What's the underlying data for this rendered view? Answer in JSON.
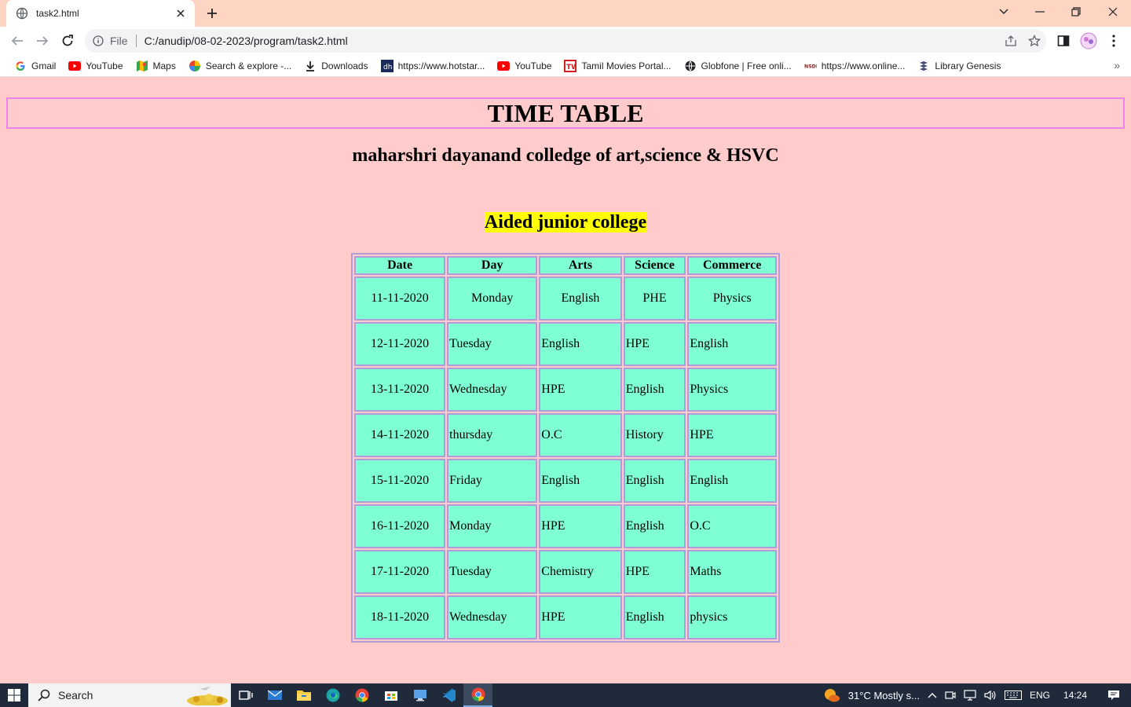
{
  "browser": {
    "tab_title": "task2.html",
    "address_prefix": "File",
    "url": "C:/anudip/08-02-2023/program/task2.html",
    "bookmarks": [
      {
        "label": "Gmail",
        "icon": "gmail-icon"
      },
      {
        "label": "YouTube",
        "icon": "youtube-icon"
      },
      {
        "label": "Maps",
        "icon": "maps-icon"
      },
      {
        "label": "Search & explore -...",
        "icon": "photos-icon"
      },
      {
        "label": "Downloads",
        "icon": "download-icon"
      },
      {
        "label": "https://www.hotstar...",
        "icon": "hotstar-icon"
      },
      {
        "label": "YouTube",
        "icon": "youtube-icon"
      },
      {
        "label": "Tamil Movies Portal...",
        "icon": "tamil-movies-icon"
      },
      {
        "label": "Globfone | Free onli...",
        "icon": "globe-icon"
      },
      {
        "label": "https://www.online...",
        "icon": "nsdl-icon"
      },
      {
        "label": "Library Genesis",
        "icon": "library-icon"
      }
    ],
    "bookmark_more": "»"
  },
  "page": {
    "title": "TIME TABLE",
    "college": "maharshri dayanand colledge of art,science & HSVC",
    "subtitle": "Aided junior college",
    "table": {
      "headers": [
        "Date",
        "Day",
        "Arts",
        "Science",
        "Commerce"
      ],
      "rows": [
        [
          "11-11-2020",
          "Monday",
          "English",
          "PHE",
          "Physics"
        ],
        [
          "12-11-2020",
          "Tuesday",
          "English",
          "HPE",
          "English"
        ],
        [
          "13-11-2020",
          "Wednesday",
          "HPE",
          "English",
          "Physics"
        ],
        [
          "14-11-2020",
          "thursday",
          "O.C",
          "History",
          "HPE"
        ],
        [
          "15-11-2020",
          "Friday",
          "English",
          "English",
          "English"
        ],
        [
          "16-11-2020",
          "Monday",
          "HPE",
          "English",
          "O.C"
        ],
        [
          "17-11-2020",
          "Tuesday",
          "Chemistry",
          "HPE",
          "Maths"
        ],
        [
          "18-11-2020",
          "Wednesday",
          "HPE",
          "English",
          "physics"
        ]
      ]
    }
  },
  "taskbar": {
    "search_label": "Search",
    "weather": "31°C  Mostly s...",
    "language": "ENG",
    "time": "14:24"
  },
  "colors": {
    "page_bg": "#ffcccb",
    "cell_bg": "#7fffd4",
    "cell_border": "#b19cd9",
    "title_border": "#ee82ee",
    "highlight": "#ffff00"
  }
}
